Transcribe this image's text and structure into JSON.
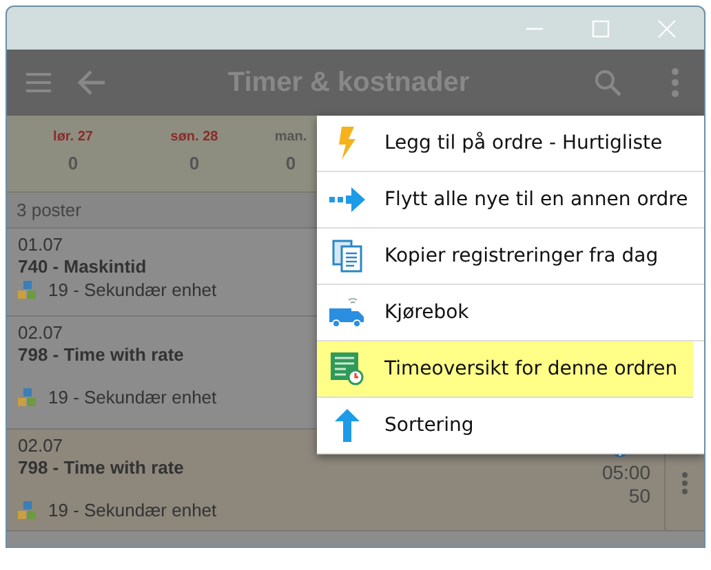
{
  "app_bar": {
    "title": "Timer & kostnader"
  },
  "days": [
    {
      "label": "lør. 27",
      "value": "0",
      "weekend": true
    },
    {
      "label": "søn. 28",
      "value": "0",
      "weekend": true
    },
    {
      "label": "man.",
      "value": "0",
      "weekend": false
    }
  ],
  "list_header": "3 poster",
  "rows": [
    {
      "date": "01.07",
      "title": "740 - Maskintid",
      "unit": "19 - Sekundær enhet",
      "selected": false
    },
    {
      "date": "02.07",
      "title": "798 - Time with rate",
      "unit": "19 - Sekundær enhet",
      "selected": false
    },
    {
      "date": "02.07",
      "title": "798 - Time with rate",
      "unit": "19 - Sekundær enhet",
      "selected": true,
      "time": "05:00",
      "amount": "50"
    }
  ],
  "menu": [
    {
      "label": "Legg til på ordre - Hurtigliste",
      "selected": false
    },
    {
      "label": "Flytt alle nye til en annen ordre",
      "selected": false
    },
    {
      "label": "Kopier registreringer fra dag",
      "selected": false
    },
    {
      "label": "Kjørebok",
      "selected": false
    },
    {
      "label": "Timeoversikt for denne ordren",
      "selected": true
    },
    {
      "label": "Sortering",
      "selected": false
    }
  ]
}
